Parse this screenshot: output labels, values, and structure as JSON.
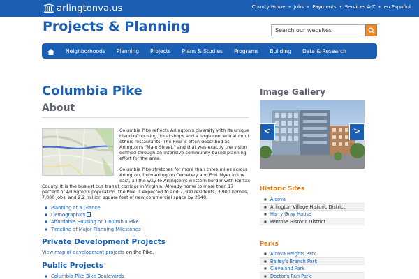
{
  "site": {
    "logo_text": "arlingtonva.us",
    "top_links": [
      "County Home",
      "Jobs",
      "Payments",
      "Services A-Z",
      "en Español"
    ]
  },
  "header": {
    "title": "Projects & Planning",
    "search_placeholder": "Search our websites"
  },
  "nav": {
    "items": [
      "Neighborhoods",
      "Planning",
      "Projects",
      "Plans & Studies",
      "Programs",
      "Building",
      "Data & Research"
    ]
  },
  "main": {
    "page_title": "Columbia Pike",
    "about_heading": "About",
    "paragraph1": "Columbia Pike reflects Arlington's diversity with its unique blend of housing, local shops and a large concentration of ethnic restaurants. The Pike is often described as Arlington's \"Main Street,\" and that was exactly the vision defined through an intensive community-based planning effort for the area.",
    "paragraph2a": "Columbia Pike stretches for more than three miles across Arlington, from Arlington Cemetery and Fort Myer in the east, all the way to Arlington's western border with Fairfax",
    "paragraph2b": "County. It is the busiest bus transit corridor in Virginia. Already home to more than 17 percent of Arlington's population, the Pike is expected to add 7,300 residents, 3,900 homes, 7,000 jobs, and 2.2 million square feet of new commercial space by 2040.",
    "links": [
      "Planning at a Glance",
      "Demographics",
      "Affordable Housing on Columbia Pike",
      "Timeline of Major Planning Milestones"
    ],
    "private_heading": "Private Development Projects",
    "dev_link": "View map of development projects",
    "dev_suffix": " on the Pike.",
    "public_heading": "Public Projects",
    "public_links": [
      "Columbia Pike Bike Boulevards"
    ]
  },
  "sidebar": {
    "gallery_title": "Image Gallery",
    "prev_label": "<",
    "next_label": ">",
    "historic_heading": "Historic Sites",
    "historic_sites": [
      {
        "label": "Alcova",
        "link": true
      },
      {
        "label": "Arlington Village Historic District",
        "link": false
      },
      {
        "label": "Harry Gray House",
        "link": true
      },
      {
        "label": "Penrose Historic District",
        "link": false
      }
    ],
    "parks_heading": "Parks",
    "parks": [
      "Alcova Heights Park",
      "Bailey's Branch Park",
      "Cleveland Park",
      "Doctor's Run Park"
    ]
  },
  "colors": {
    "brand_blue": "#1a5fb4",
    "accent_orange": "#e07b1a",
    "heading_gray": "#5d6470"
  }
}
